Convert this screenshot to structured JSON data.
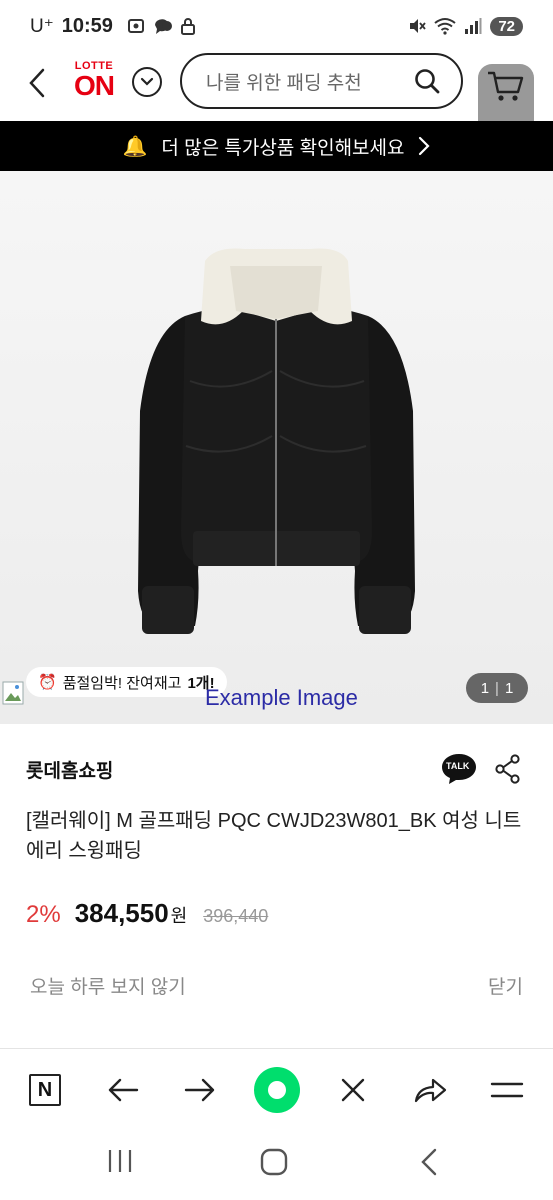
{
  "status_bar": {
    "carrier": "U⁺",
    "time": "10:59",
    "battery": "72"
  },
  "header": {
    "logo_top": "LOTTE",
    "logo_main": "ON",
    "search_placeholder": "나를 위한 패딩 추천"
  },
  "promo_bar": {
    "text": "더 많은 특가상품 확인해보세요"
  },
  "product_image": {
    "stock_badge_prefix": "품절임박! 잔여재고",
    "stock_badge_count": "1개!",
    "example_label": "Example Image",
    "page_current": "1",
    "page_total": "1"
  },
  "product": {
    "seller": "롯데홈쇼핑",
    "talk_label": "TALK",
    "name": "[캘러웨이] M 골프패딩 PQC CWJD23W801_BK 여성 니트에리 스윙패딩",
    "discount": "2%",
    "price": "384,550",
    "currency": "원",
    "original_price": "396,440"
  },
  "footer_links": {
    "hide_today": "오늘 하루 보지 않기",
    "close": "닫기"
  },
  "toolbar": {
    "n_label": "N"
  },
  "colors": {
    "brand_red": "#e60012",
    "discount_red": "#e03a3a",
    "promo_bg": "#000000",
    "green_button": "#00de6d"
  }
}
